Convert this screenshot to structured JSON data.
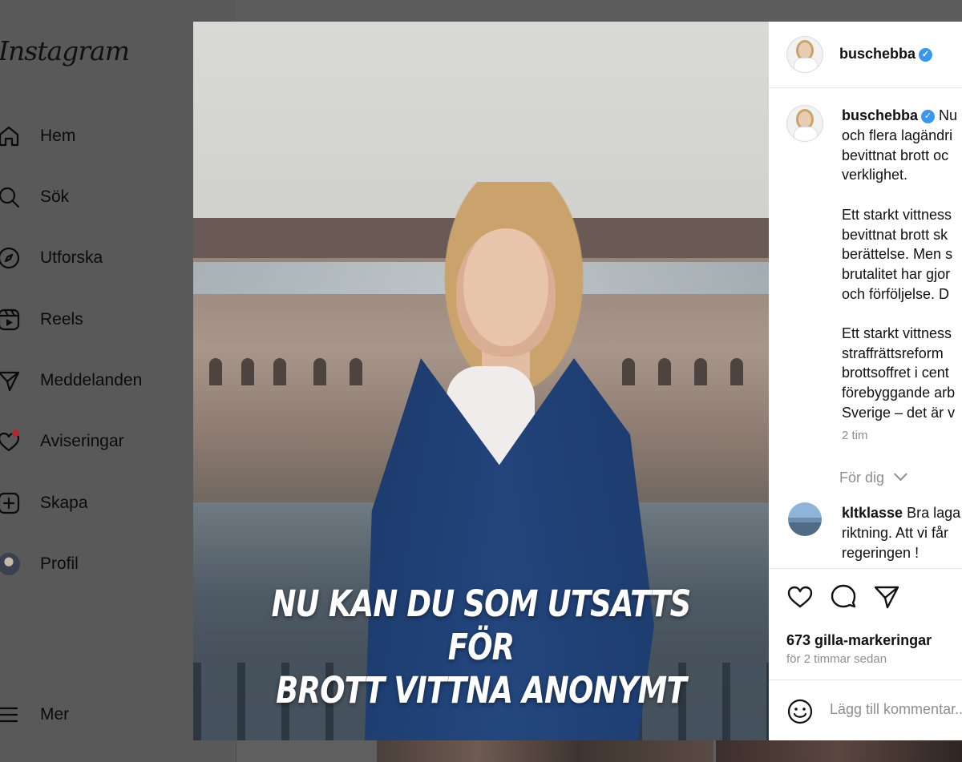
{
  "app": {
    "logo_text": "Instagram"
  },
  "sidebar": {
    "items": [
      {
        "label": "Hem",
        "icon": "home-icon"
      },
      {
        "label": "Sök",
        "icon": "search-icon"
      },
      {
        "label": "Utforska",
        "icon": "compass-icon"
      },
      {
        "label": "Reels",
        "icon": "reels-icon"
      },
      {
        "label": "Meddelanden",
        "icon": "send-icon"
      },
      {
        "label": "Aviseringar",
        "icon": "heart-icon"
      },
      {
        "label": "Skapa",
        "icon": "plus-square-icon"
      },
      {
        "label": "Profil",
        "icon": "avatar"
      }
    ],
    "more_label": "Mer",
    "notification_dot_color": "#b3272d"
  },
  "post": {
    "image_headline_line1": "NU KAN DU SOM UTSATTS FÖR",
    "image_headline_line2": "BROTT VITTNA ANONYMT",
    "author": "buschebba",
    "verified_color": "#3a97f0",
    "caption": {
      "username": "buschebba",
      "line1_rest": "Nu",
      "lines": [
        "och flera lagändri",
        "bevittnat brott oc",
        "verklighet.",
        "",
        "Ett starkt vittness",
        "bevittnat brott sk",
        "berättelse. Men s",
        "brutalitet har gjor",
        "och förföljelse. D",
        "",
        "Ett starkt vittness",
        "straffrättsreform",
        "brottsoffret i cent",
        "förebyggande arb",
        "Sverige – det är v"
      ]
    },
    "time_ago": "2 tim",
    "for_you_label": "För dig",
    "comment": {
      "username": "kltklasse",
      "line1_rest": "Bra laga",
      "lines": [
        "riktning. Att vi får",
        "regeringen !"
      ]
    },
    "likes": "673 gilla-markeringar",
    "posted": "för 2 timmar sedan",
    "comment_placeholder": "Lägg till kommentar..."
  }
}
